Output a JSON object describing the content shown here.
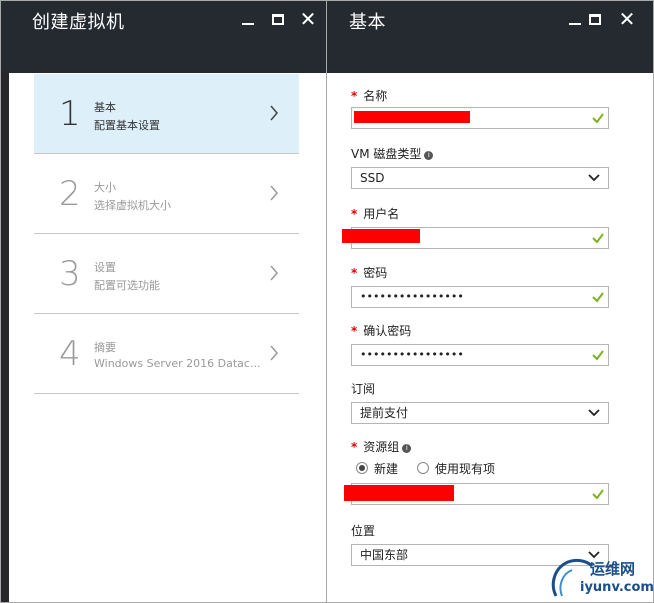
{
  "left_blade": {
    "title": "创建虚拟机",
    "steps": [
      {
        "number": "1",
        "title": "基本",
        "subtitle": "配置基本设置"
      },
      {
        "number": "2",
        "title": "大小",
        "subtitle": "选择虚拟机大小"
      },
      {
        "number": "3",
        "title": "设置",
        "subtitle": "配置可选功能"
      },
      {
        "number": "4",
        "title": "摘要",
        "subtitle": "Windows Server 2016 Datac..."
      }
    ]
  },
  "right_blade": {
    "title": "基本",
    "required_mark": "*",
    "fields": {
      "name": {
        "label": "名称",
        "value": ""
      },
      "disk_type": {
        "label": "VM 磁盘类型",
        "info": "i",
        "value": "SSD"
      },
      "username": {
        "label": "用户名",
        "value": ""
      },
      "password": {
        "label": "密码",
        "value": "••••••••••••••••"
      },
      "confirm_password": {
        "label": "确认密码",
        "value": "••••••••••••••••"
      },
      "subscription": {
        "label": "订阅",
        "value": "提前支付"
      },
      "resource_group": {
        "label": "资源组",
        "info": "i",
        "options": [
          "新建",
          "使用现有项"
        ],
        "selected": "新建",
        "value": ""
      },
      "location": {
        "label": "位置",
        "value": "中国东部"
      }
    }
  },
  "watermark": {
    "main": "运维网",
    "sub": "iyunv.com"
  },
  "colors": {
    "header_bg": "#252a31",
    "active_step_bg": "#ddf0fa",
    "check_green": "#7bb31f",
    "required_red": "#e00000",
    "redaction_red": "#ff0000"
  }
}
